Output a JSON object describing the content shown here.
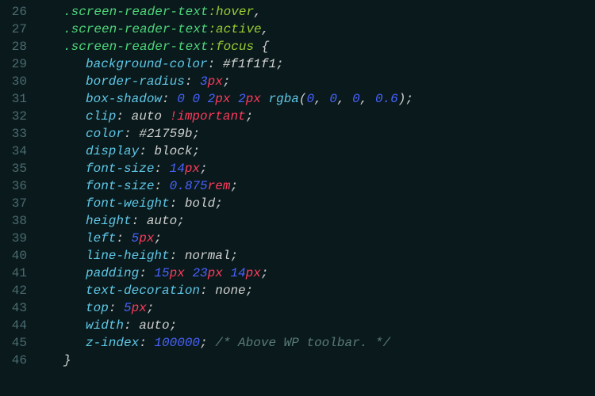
{
  "lines": {
    "26": {
      "num": "26",
      "indent": "indent1",
      "selector": ".screen-reader-text",
      "pseudo": ":hover",
      "end": ","
    },
    "27": {
      "num": "27",
      "indent": "indent1",
      "selector": ".screen-reader-text",
      "pseudo": ":active",
      "end": ","
    },
    "28": {
      "num": "28",
      "indent": "indent1",
      "selector": ".screen-reader-text",
      "pseudo": ":focus",
      "brace": " {"
    },
    "29": {
      "num": "29",
      "indent": "indent2",
      "prop": "background-color",
      "colon": ": ",
      "hex": "#f1f1f1",
      "semi": ";"
    },
    "30": {
      "num": "30",
      "indent": "indent2",
      "prop": "border-radius",
      "colon": ": ",
      "n1": "3",
      "u1": "px",
      "semi": ";"
    },
    "31": {
      "num": "31",
      "indent": "indent2",
      "prop": "box-shadow",
      "colon": ": ",
      "n1": "0",
      "s1": " ",
      "n2": "0",
      "s2": " ",
      "n3": "2",
      "u3": "px",
      "s3": " ",
      "n4": "2",
      "u4": "px",
      "s4": " ",
      "func": "rgba",
      "paren1": "(",
      "a1": "0",
      "c1": ", ",
      "a2": "0",
      "c2": ", ",
      "a3": "0",
      "c3": ", ",
      "a4": "0.6",
      "paren2": ")",
      "semi": ";"
    },
    "32": {
      "num": "32",
      "indent": "indent2",
      "prop": "clip",
      "colon": ": ",
      "val": "auto ",
      "kw": "!important",
      "semi": ";"
    },
    "33": {
      "num": "33",
      "indent": "indent2",
      "prop": "color",
      "colon": ": ",
      "hex": "#21759b",
      "semi": ";"
    },
    "34": {
      "num": "34",
      "indent": "indent2",
      "prop": "display",
      "colon": ": ",
      "val": "block",
      "semi": ";"
    },
    "35": {
      "num": "35",
      "indent": "indent2",
      "prop": "font-size",
      "colon": ": ",
      "n1": "14",
      "u1": "px",
      "semi": ";"
    },
    "36": {
      "num": "36",
      "indent": "indent2",
      "prop": "font-size",
      "colon": ": ",
      "n1": "0.875",
      "u1": "rem",
      "semi": ";"
    },
    "37": {
      "num": "37",
      "indent": "indent2",
      "prop": "font-weight",
      "colon": ": ",
      "val": "bold",
      "semi": ";"
    },
    "38": {
      "num": "38",
      "indent": "indent2",
      "prop": "height",
      "colon": ": ",
      "val": "auto",
      "semi": ";"
    },
    "39": {
      "num": "39",
      "indent": "indent2",
      "prop": "left",
      "colon": ": ",
      "n1": "5",
      "u1": "px",
      "semi": ";"
    },
    "40": {
      "num": "40",
      "indent": "indent2",
      "prop": "line-height",
      "colon": ": ",
      "val": "normal",
      "semi": ";"
    },
    "41": {
      "num": "41",
      "indent": "indent2",
      "prop": "padding",
      "colon": ": ",
      "n1": "15",
      "u1": "px",
      "s1": " ",
      "n2": "23",
      "u2": "px",
      "s2": " ",
      "n3": "14",
      "u3": "px",
      "semi": ";"
    },
    "42": {
      "num": "42",
      "indent": "indent2",
      "prop": "text-decoration",
      "colon": ": ",
      "val": "none",
      "semi": ";"
    },
    "43": {
      "num": "43",
      "indent": "indent2",
      "prop": "top",
      "colon": ": ",
      "n1": "5",
      "u1": "px",
      "semi": ";"
    },
    "44": {
      "num": "44",
      "indent": "indent2",
      "prop": "width",
      "colon": ": ",
      "val": "auto",
      "semi": ";"
    },
    "45": {
      "num": "45",
      "indent": "indent2",
      "prop": "z-index",
      "colon": ": ",
      "n1": "100000",
      "semi": ";",
      "sp": " ",
      "comment": "/* Above WP toolbar. */"
    },
    "46": {
      "num": "46",
      "indent": "indent1",
      "brace": "}"
    }
  }
}
